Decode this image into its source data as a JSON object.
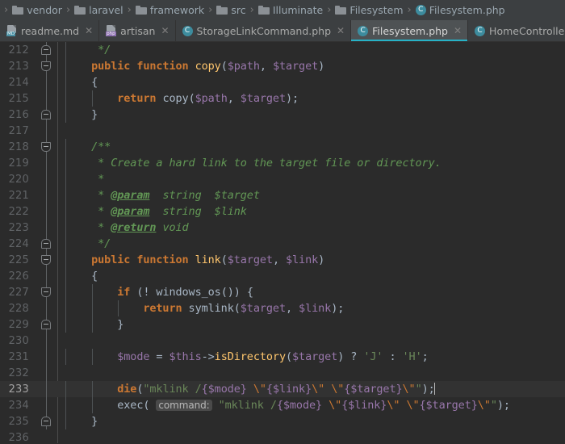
{
  "breadcrumb": {
    "leading_separator": "›",
    "separator": "›",
    "items": [
      {
        "label": "vendor",
        "icon": "folder-icon"
      },
      {
        "label": "laravel",
        "icon": "folder-icon"
      },
      {
        "label": "framework",
        "icon": "folder-icon"
      },
      {
        "label": "src",
        "icon": "folder-icon"
      },
      {
        "label": "Illuminate",
        "icon": "folder-icon"
      },
      {
        "label": "Filesystem",
        "icon": "folder-icon"
      },
      {
        "label": "Filesystem.php",
        "icon": "php-class-icon",
        "icon_glyph": "C"
      }
    ]
  },
  "tabs": {
    "close_glyph": "✕",
    "overflow_glyph": "›",
    "items": [
      {
        "label": "readme.md",
        "icon": "markdown-file-icon",
        "badge": "MD",
        "active": false,
        "closable": true
      },
      {
        "label": "artisan",
        "icon": "php-file-icon",
        "badge": "php",
        "active": false,
        "closable": true
      },
      {
        "label": "StorageLinkCommand.php",
        "icon": "php-class-icon",
        "icon_glyph": "C",
        "active": false,
        "closable": true
      },
      {
        "label": "Filesystem.php",
        "icon": "php-class-icon",
        "icon_glyph": "C",
        "active": true,
        "closable": true
      },
      {
        "label": "HomeController.php",
        "icon": "php-class-icon",
        "icon_glyph": "C",
        "active": false,
        "closable": false
      }
    ]
  },
  "colors": {
    "editor_background": "#2b2b2b",
    "chrome_background": "#3c3f41",
    "active_tab_background": "#4e5254",
    "active_tab_underline": "#27b2c6",
    "current_line_background": "#323232",
    "keyword": "#cc7832",
    "function": "#ffc66d",
    "variable": "#9876aa",
    "string": "#6a8759",
    "comment": "#629755",
    "default_text": "#a9b7c6",
    "line_number": "#606366",
    "inlay_hint_background": "#4a4a4a"
  },
  "editor": {
    "caret_line": 233,
    "lines": [
      {
        "num": "212",
        "fold": "end",
        "indent_guides": [
          0
        ],
        "tokens": [
          {
            "t": "    ",
            "c": "punct"
          },
          {
            "t": " */",
            "c": "cmt"
          }
        ]
      },
      {
        "num": "213",
        "fold": "start",
        "indent_guides": [
          0
        ],
        "tokens": [
          {
            "t": "    ",
            "c": "punct"
          },
          {
            "t": "public function ",
            "c": "kw"
          },
          {
            "t": "copy",
            "c": "fn"
          },
          {
            "t": "(",
            "c": "punct"
          },
          {
            "t": "$path",
            "c": "var"
          },
          {
            "t": ", ",
            "c": "punct"
          },
          {
            "t": "$target",
            "c": "var"
          },
          {
            "t": ")",
            "c": "punct"
          }
        ]
      },
      {
        "num": "214",
        "fold": "bar",
        "indent_guides": [
          0
        ],
        "tokens": [
          {
            "t": "    {",
            "c": "punct"
          }
        ]
      },
      {
        "num": "215",
        "fold": "bar",
        "indent_guides": [
          0,
          1
        ],
        "tokens": [
          {
            "t": "        ",
            "c": "punct"
          },
          {
            "t": "return ",
            "c": "kw"
          },
          {
            "t": "copy",
            "c": "ident"
          },
          {
            "t": "(",
            "c": "punct"
          },
          {
            "t": "$path",
            "c": "var"
          },
          {
            "t": ", ",
            "c": "punct"
          },
          {
            "t": "$target",
            "c": "var"
          },
          {
            "t": ");",
            "c": "punct"
          }
        ]
      },
      {
        "num": "216",
        "fold": "end",
        "indent_guides": [
          0
        ],
        "tokens": [
          {
            "t": "    }",
            "c": "punct"
          }
        ]
      },
      {
        "num": "217",
        "fold": "bar",
        "indent_guides": [],
        "tokens": []
      },
      {
        "num": "218",
        "fold": "start",
        "indent_guides": [
          0
        ],
        "tokens": [
          {
            "t": "    ",
            "c": "punct"
          },
          {
            "t": "/**",
            "c": "cmt"
          }
        ]
      },
      {
        "num": "219",
        "fold": "bar",
        "indent_guides": [
          0
        ],
        "tokens": [
          {
            "t": "    ",
            "c": "punct"
          },
          {
            "t": " * Create a hard link to the target file or directory.",
            "c": "cmt"
          }
        ]
      },
      {
        "num": "220",
        "fold": "bar",
        "indent_guides": [
          0
        ],
        "tokens": [
          {
            "t": "    ",
            "c": "punct"
          },
          {
            "t": " *",
            "c": "cmt"
          }
        ]
      },
      {
        "num": "221",
        "fold": "bar",
        "indent_guides": [
          0
        ],
        "tokens": [
          {
            "t": "    ",
            "c": "punct"
          },
          {
            "t": " * ",
            "c": "cmt"
          },
          {
            "t": "@param",
            "c": "tag"
          },
          {
            "t": "  string  $target",
            "c": "cmt"
          }
        ]
      },
      {
        "num": "222",
        "fold": "bar",
        "indent_guides": [
          0
        ],
        "tokens": [
          {
            "t": "    ",
            "c": "punct"
          },
          {
            "t": " * ",
            "c": "cmt"
          },
          {
            "t": "@param",
            "c": "tag"
          },
          {
            "t": "  string  $link",
            "c": "cmt"
          }
        ]
      },
      {
        "num": "223",
        "fold": "bar",
        "indent_guides": [
          0
        ],
        "tokens": [
          {
            "t": "    ",
            "c": "punct"
          },
          {
            "t": " * ",
            "c": "cmt"
          },
          {
            "t": "@return",
            "c": "tag"
          },
          {
            "t": " void",
            "c": "cmt"
          }
        ]
      },
      {
        "num": "224",
        "fold": "end",
        "indent_guides": [
          0
        ],
        "tokens": [
          {
            "t": "    ",
            "c": "punct"
          },
          {
            "t": " */",
            "c": "cmt"
          }
        ]
      },
      {
        "num": "225",
        "fold": "start",
        "indent_guides": [
          0
        ],
        "tokens": [
          {
            "t": "    ",
            "c": "punct"
          },
          {
            "t": "public function ",
            "c": "kw"
          },
          {
            "t": "link",
            "c": "fn"
          },
          {
            "t": "(",
            "c": "punct"
          },
          {
            "t": "$target",
            "c": "var"
          },
          {
            "t": ", ",
            "c": "punct"
          },
          {
            "t": "$link",
            "c": "var"
          },
          {
            "t": ")",
            "c": "punct"
          }
        ]
      },
      {
        "num": "226",
        "fold": "bar",
        "indent_guides": [
          0
        ],
        "tokens": [
          {
            "t": "    {",
            "c": "punct"
          }
        ]
      },
      {
        "num": "227",
        "fold": "start",
        "indent_guides": [
          0,
          1
        ],
        "tokens": [
          {
            "t": "        ",
            "c": "punct"
          },
          {
            "t": "if",
            "c": "kw"
          },
          {
            "t": " (! ",
            "c": "punct"
          },
          {
            "t": "windows_os",
            "c": "ident"
          },
          {
            "t": "()) {",
            "c": "punct"
          }
        ]
      },
      {
        "num": "228",
        "fold": "bar",
        "indent_guides": [
          0,
          1,
          2
        ],
        "tokens": [
          {
            "t": "            ",
            "c": "punct"
          },
          {
            "t": "return ",
            "c": "kw"
          },
          {
            "t": "symlink",
            "c": "ident"
          },
          {
            "t": "(",
            "c": "punct"
          },
          {
            "t": "$target",
            "c": "var"
          },
          {
            "t": ", ",
            "c": "punct"
          },
          {
            "t": "$link",
            "c": "var"
          },
          {
            "t": ");",
            "c": "punct"
          }
        ]
      },
      {
        "num": "229",
        "fold": "end",
        "indent_guides": [
          0,
          1
        ],
        "tokens": [
          {
            "t": "        }",
            "c": "punct"
          }
        ]
      },
      {
        "num": "230",
        "fold": "bar",
        "indent_guides": [],
        "tokens": []
      },
      {
        "num": "231",
        "fold": "bar",
        "indent_guides": [
          0,
          1
        ],
        "tokens": [
          {
            "t": "        ",
            "c": "punct"
          },
          {
            "t": "$mode",
            "c": "var"
          },
          {
            "t": " = ",
            "c": "punct"
          },
          {
            "t": "$this",
            "c": "var"
          },
          {
            "t": "->",
            "c": "punct"
          },
          {
            "t": "isDirectory",
            "c": "fn"
          },
          {
            "t": "(",
            "c": "punct"
          },
          {
            "t": "$target",
            "c": "var"
          },
          {
            "t": ") ? ",
            "c": "punct"
          },
          {
            "t": "'J'",
            "c": "str"
          },
          {
            "t": " : ",
            "c": "punct"
          },
          {
            "t": "'H'",
            "c": "str"
          },
          {
            "t": ";",
            "c": "punct"
          }
        ]
      },
      {
        "num": "232",
        "fold": "bar",
        "indent_guides": [],
        "tokens": []
      },
      {
        "num": "233",
        "fold": "bar",
        "current": true,
        "indent_guides": [
          0,
          1
        ],
        "tokens": [
          {
            "t": "        ",
            "c": "punct"
          },
          {
            "t": "die",
            "c": "kw"
          },
          {
            "t": "(",
            "c": "punct"
          },
          {
            "t": "\"mklink /",
            "c": "str"
          },
          {
            "t": "{$mode}",
            "c": "var"
          },
          {
            "t": " ",
            "c": "str"
          },
          {
            "t": "\\\"",
            "c": "esc"
          },
          {
            "t": "{$link}",
            "c": "var"
          },
          {
            "t": "\\\"",
            "c": "esc"
          },
          {
            "t": " ",
            "c": "str"
          },
          {
            "t": "\\\"",
            "c": "esc"
          },
          {
            "t": "{$target}",
            "c": "var"
          },
          {
            "t": "\\\"",
            "c": "esc"
          },
          {
            "t": "\"",
            "c": "str"
          },
          {
            "t": ");",
            "c": "punct"
          },
          {
            "t": "",
            "c": "caret"
          }
        ]
      },
      {
        "num": "234",
        "fold": "bar",
        "indent_guides": [
          0,
          1
        ],
        "tokens": [
          {
            "t": "        ",
            "c": "punct"
          },
          {
            "t": "exec",
            "c": "ident"
          },
          {
            "t": "( ",
            "c": "punct"
          },
          {
            "t": "command:",
            "c": "hint"
          },
          {
            "t": " ",
            "c": "punct"
          },
          {
            "t": "\"mklink /",
            "c": "str"
          },
          {
            "t": "{$mode}",
            "c": "var"
          },
          {
            "t": " ",
            "c": "str"
          },
          {
            "t": "\\\"",
            "c": "esc"
          },
          {
            "t": "{$link}",
            "c": "var"
          },
          {
            "t": "\\\"",
            "c": "esc"
          },
          {
            "t": " ",
            "c": "str"
          },
          {
            "t": "\\\"",
            "c": "esc"
          },
          {
            "t": "{$target}",
            "c": "var"
          },
          {
            "t": "\\\"",
            "c": "esc"
          },
          {
            "t": "\"",
            "c": "str"
          },
          {
            "t": ");",
            "c": "punct"
          }
        ]
      },
      {
        "num": "235",
        "fold": "end",
        "indent_guides": [
          0
        ],
        "tokens": [
          {
            "t": "    }",
            "c": "punct"
          }
        ]
      },
      {
        "num": "236",
        "fold": "none",
        "indent_guides": [],
        "tokens": []
      }
    ]
  }
}
